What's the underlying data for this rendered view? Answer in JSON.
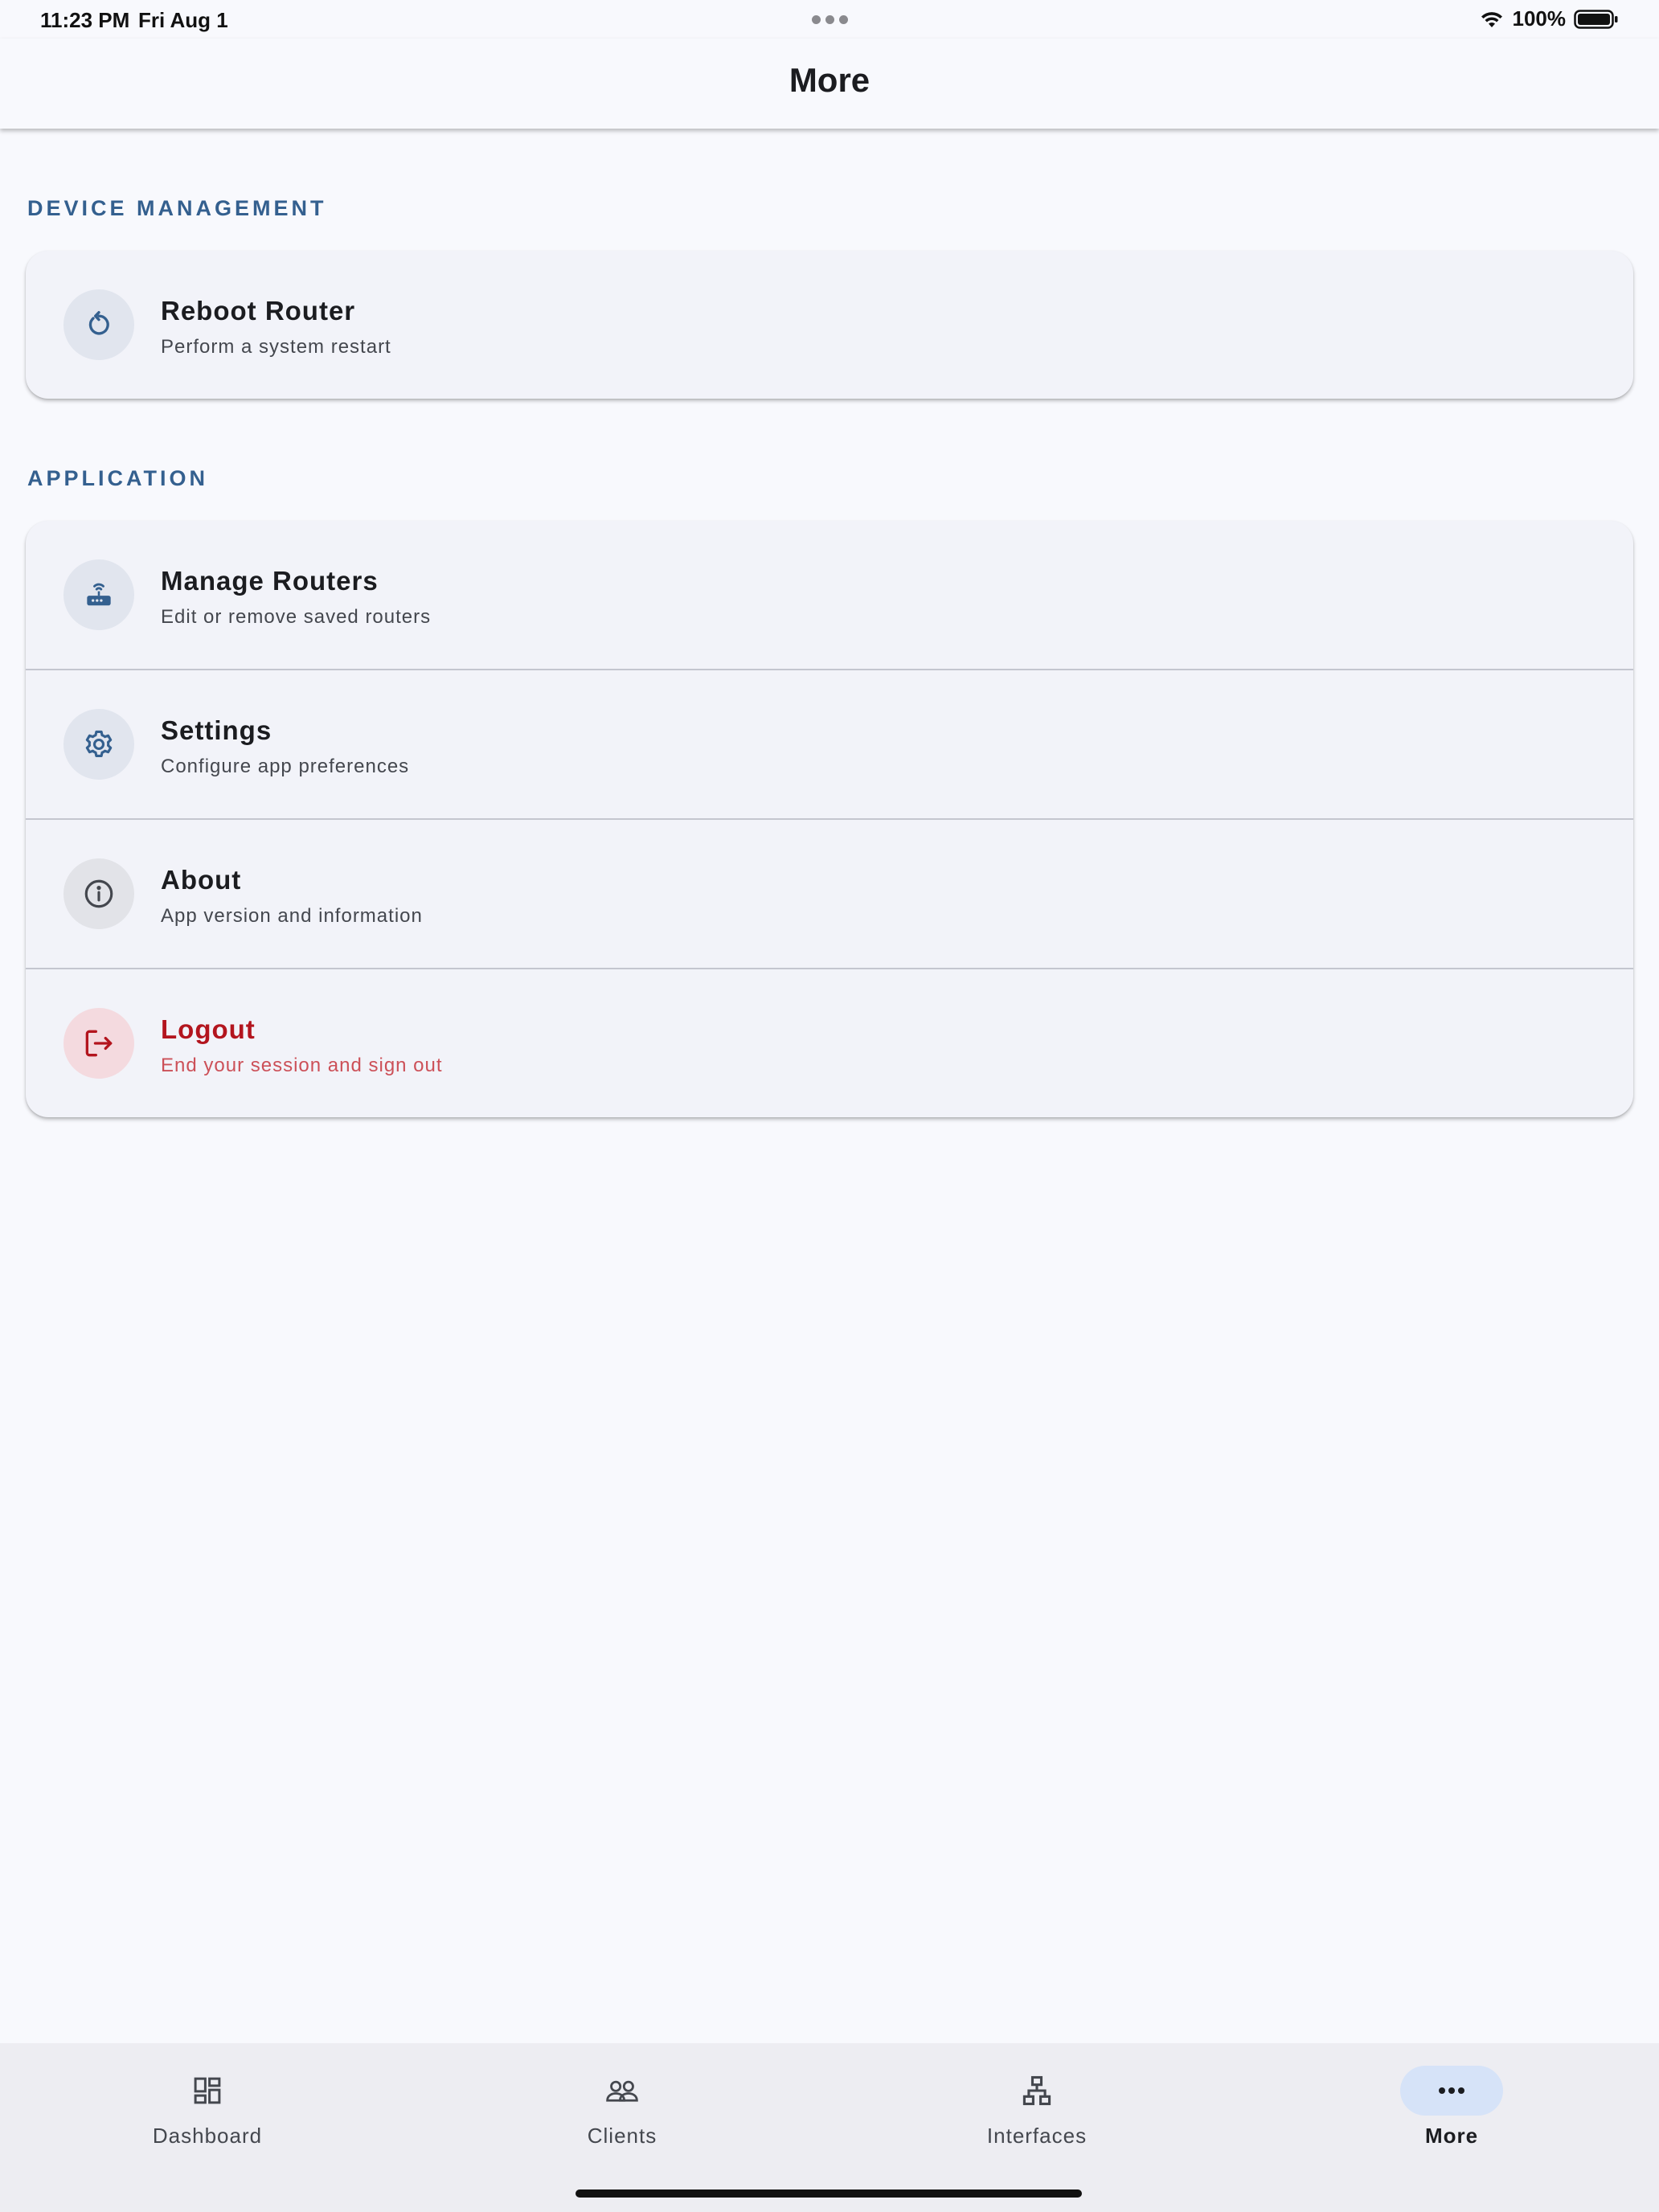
{
  "status_bar": {
    "time": "11:23 PM",
    "date": "Fri Aug 1",
    "battery": "100%"
  },
  "header": {
    "title": "More"
  },
  "sections": [
    {
      "heading": "DEVICE MANAGEMENT",
      "items": [
        {
          "title": "Reboot Router",
          "subtitle": "Perform a system restart",
          "icon": "restart-icon"
        }
      ]
    },
    {
      "heading": "APPLICATION",
      "items": [
        {
          "title": "Manage Routers",
          "subtitle": "Edit or remove saved routers",
          "icon": "router-icon"
        },
        {
          "title": "Settings",
          "subtitle": "Configure app preferences",
          "icon": "gear-icon"
        },
        {
          "title": "About",
          "subtitle": "App version and information",
          "icon": "info-icon"
        },
        {
          "title": "Logout",
          "subtitle": "End your session and sign out",
          "icon": "logout-icon"
        }
      ]
    }
  ],
  "bottom_nav": {
    "items": [
      {
        "label": "Dashboard",
        "icon": "dashboard-icon"
      },
      {
        "label": "Clients",
        "icon": "people-icon"
      },
      {
        "label": "Interfaces",
        "icon": "network-icon"
      },
      {
        "label": "More",
        "icon": "more-horiz-icon",
        "active": true
      }
    ]
  },
  "colors": {
    "accent": "#34608f",
    "danger": "#b3151e",
    "background": "#f8f9fd",
    "card": "#f2f3f9",
    "active_pill": "#d6e3f8"
  }
}
